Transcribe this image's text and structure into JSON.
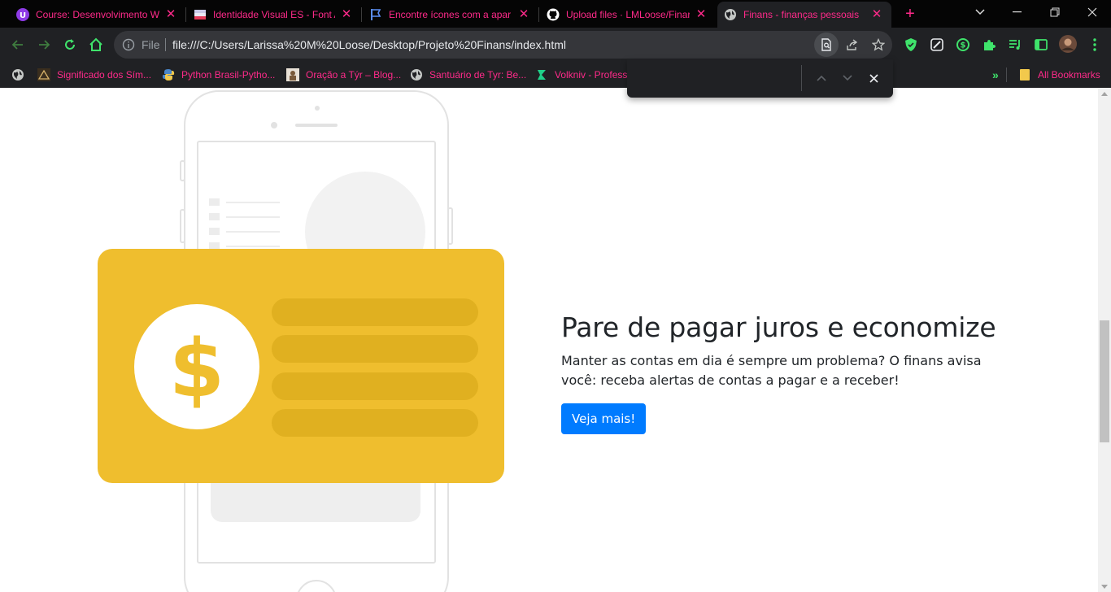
{
  "browser": {
    "tabs": [
      {
        "title": "Course: Desenvolvimento W",
        "icon": "course-icon"
      },
      {
        "title": "Identidade Visual ES - Font A",
        "icon": "flag-es-icon"
      },
      {
        "title": "Encontre ícones com a apar",
        "icon": "flag-outline-icon"
      },
      {
        "title": "Upload files · LMLoose/Finar",
        "icon": "github-icon"
      },
      {
        "title": "Finans - finanças pessoais",
        "icon": "globe-icon",
        "active": true
      }
    ],
    "url_scheme": "File",
    "url": "file:///C:/Users/Larissa%20M%20Loose/Desktop/Projeto%20Finans/index.html",
    "bookmarks": [
      {
        "label": "Significado dos Sím...",
        "icon": "triangle-icon"
      },
      {
        "label": "Python Brasil-Pytho...",
        "icon": "python-icon"
      },
      {
        "label": "Oração a Týr – Blog...",
        "icon": "blog-icon"
      },
      {
        "label": "Santuário de Tyr: Be...",
        "icon": "globe-icon"
      },
      {
        "label": "Volkniv - Profess",
        "icon": "volkniv-icon"
      }
    ],
    "all_bookmarks_label": "All Bookmarks",
    "find": {
      "value": ""
    },
    "accent": "#ff2a8a"
  },
  "page": {
    "title": "Pare de pagar juros e economize",
    "description": "Manter as contas em dia é sempre um problema? O finans avisa você: receba alertas de contas a pagar e a receber!",
    "cta_label": "Veja mais!",
    "illustration": {
      "card_color": "#efbe2e",
      "symbol": "$",
      "bar_color": "#e0b020"
    },
    "button_color": "#007bff"
  }
}
